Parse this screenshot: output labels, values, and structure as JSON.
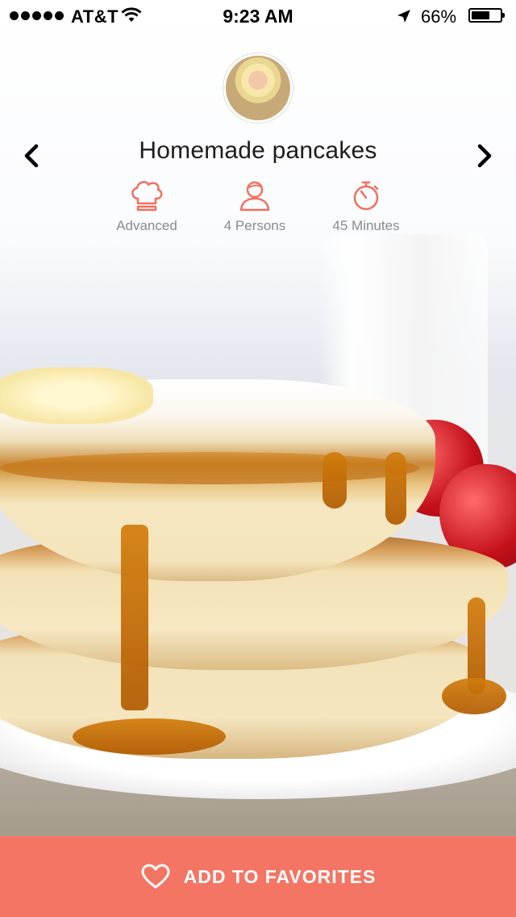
{
  "status_bar": {
    "carrier": "AT&T",
    "time": "9:23 AM",
    "battery": "66%",
    "battery_level": 0.66
  },
  "recipe": {
    "title": "Homemade pancakes",
    "meta": [
      {
        "icon": "chef-hat-icon",
        "label": "Advanced"
      },
      {
        "icon": "person-icon",
        "label": "4 Persons"
      },
      {
        "icon": "stopwatch-icon",
        "label": "45 Minutes"
      }
    ]
  },
  "actions": {
    "favorites_label": "ADD TO FAVORITES"
  },
  "colors": {
    "accent": "#f47564",
    "icon": "#f2705e",
    "meta_text": "#8b8b8b",
    "title_text": "#1d1d1d"
  }
}
